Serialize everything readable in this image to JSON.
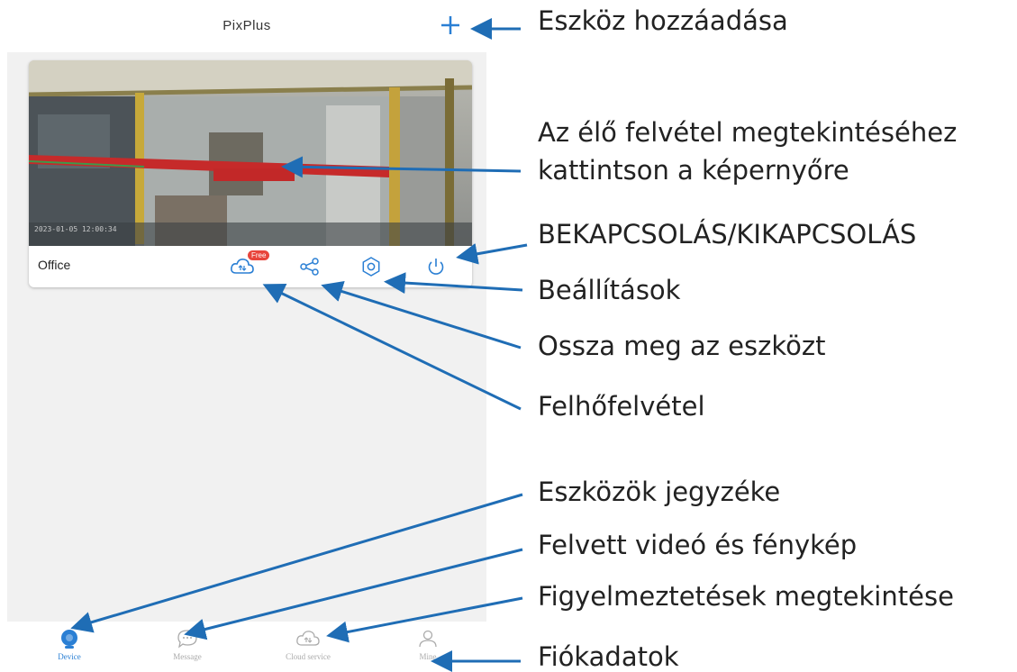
{
  "app": {
    "title": "PixPlus",
    "add_icon": "plus-icon"
  },
  "device_card": {
    "name": "Office",
    "cloud_badge": "Free",
    "icons": [
      "cloud-recording-icon",
      "share-icon",
      "settings-icon",
      "power-icon"
    ]
  },
  "bottom_nav": {
    "items": [
      {
        "label": "Device",
        "icon": "device-icon",
        "active": true
      },
      {
        "label": "Message",
        "icon": "message-icon",
        "active": false
      },
      {
        "label": "Cloud service",
        "icon": "cloud-service-icon",
        "active": false
      },
      {
        "label": "Mine",
        "icon": "user-icon",
        "active": false
      }
    ]
  },
  "annotations": {
    "add_device": "Eszköz hozzáadása",
    "live_view_line1": "Az élő felvétel megtekintéséhez",
    "live_view_line2": "kattintson a képernyőre",
    "power": "BEKAPCSOLÁS/KIKAPCSOLÁS",
    "settings": "Beállítások",
    "share": "Ossza meg az eszközt",
    "cloud": "Felhőfelvétel",
    "device_list": "Eszközök jegyzéke",
    "media": "Felvett videó és fénykép",
    "alerts": "Figyelmeztetések megtekintése",
    "account": "Fiókadatok"
  },
  "colors": {
    "accent": "#2a7fd4",
    "arrow": "#1f6db5",
    "badge": "#e8453c",
    "background": "#f1f1f1"
  }
}
